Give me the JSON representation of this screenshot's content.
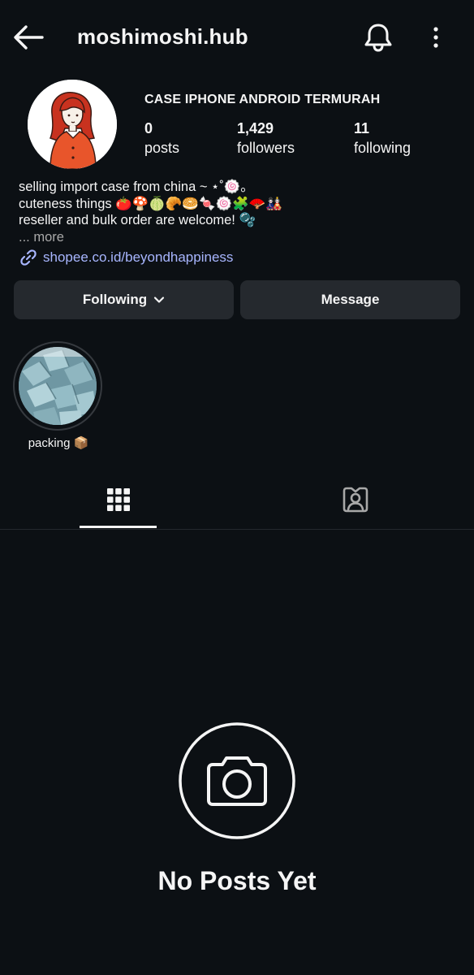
{
  "header": {
    "username": "moshimoshi.hub",
    "back_icon": "arrow-left-icon",
    "notifications_icon": "bell-icon",
    "menu_icon": "more-vertical-icon"
  },
  "profile": {
    "name": "CASE IPHONE ANDROID TERMURAH",
    "stats": [
      {
        "value": "0",
        "label": "posts"
      },
      {
        "value": "1,429",
        "label": "followers"
      },
      {
        "value": "11",
        "label": "following"
      }
    ],
    "bio": [
      "selling import case from china ~ ⋆˚🍥｡",
      "cuteness things 🍅🍄🍈🥐🥯🍬🍥🧩🪭🎎",
      "reseller and bulk order are welcome! 🫧"
    ],
    "more": "... more",
    "link": "shopee.co.id/beyondhappiness"
  },
  "actions": {
    "following": "Following",
    "message": "Message"
  },
  "highlights": [
    {
      "label": "packing 📦"
    }
  ],
  "tabs": {
    "active": "posts-grid",
    "items": [
      "grid-icon",
      "tagged-icon"
    ]
  },
  "empty_state": {
    "title": "No Posts Yet",
    "icon": "camera-icon"
  },
  "colors": {
    "background": "#0c1014",
    "button": "#25292e",
    "link": "#a8b6ff",
    "text": "#f5f5f5"
  }
}
